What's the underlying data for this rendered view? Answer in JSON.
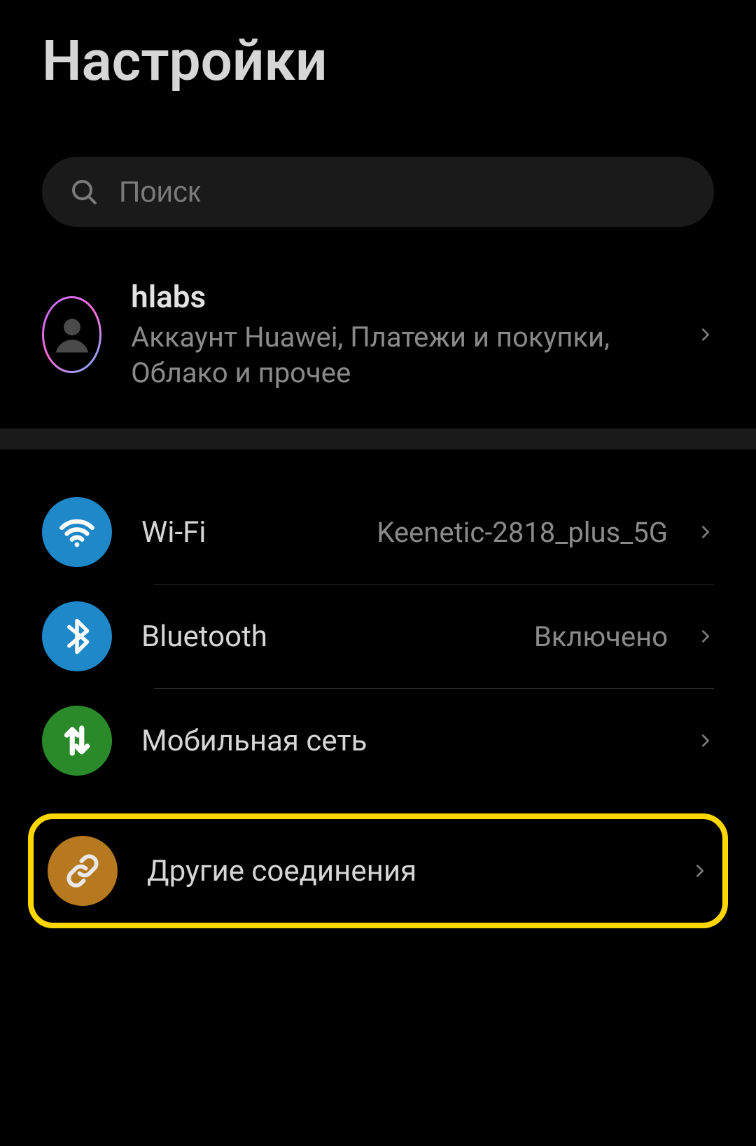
{
  "header": {
    "title": "Настройки"
  },
  "search": {
    "placeholder": "Поиск"
  },
  "account": {
    "name": "hlabs",
    "subtitle": "Аккаунт Huawei, Платежи и покупки, Облако и прочее"
  },
  "items": {
    "wifi": {
      "label": "Wi-Fi",
      "value": "Keenetic-2818_plus_5G",
      "color": "#1e88c9"
    },
    "bt": {
      "label": "Bluetooth",
      "value": "Включено",
      "color": "#1e88c9"
    },
    "mobile": {
      "label": "Мобильная сеть",
      "value": "",
      "color": "#2a8a2a"
    },
    "more": {
      "label": "Другие соединения",
      "value": "",
      "color": "#b7791f"
    }
  }
}
